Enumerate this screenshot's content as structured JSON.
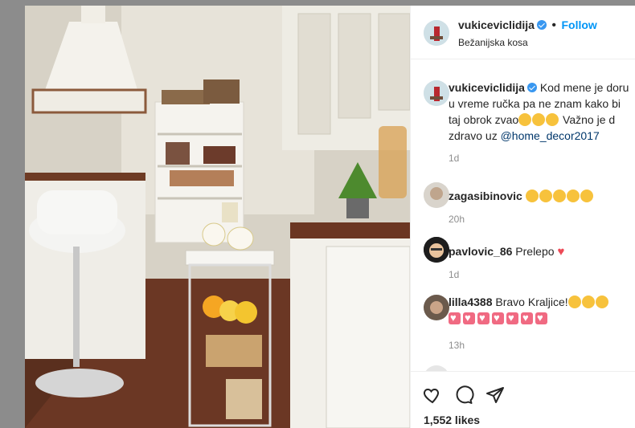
{
  "post": {
    "username": "vukiceviclidija",
    "follow_label": "Follow",
    "location": "Bežanijska kosa",
    "caption_lines": [
      "Kod mene je doru",
      "u vreme ručka pa ne znam kako bi",
      "taj obrok zvao",
      " Važno je d",
      "zdravo uz "
    ],
    "caption_mention": "@home_decor2017",
    "caption_time": "1d",
    "likes": "1,552 likes"
  },
  "comments": [
    {
      "user": "zagasibinovic",
      "text": "",
      "time": "20h"
    },
    {
      "user": "pavlovic_86",
      "text": "Prelepo",
      "time": "1d"
    },
    {
      "user": "lilla4388",
      "text": "Bravo Kraljice!",
      "time": "13h"
    }
  ],
  "icons": [
    "verified-badge",
    "heart-icon",
    "comment-icon",
    "share-icon"
  ],
  "colors": {
    "accent": "#0095f6",
    "mention": "#00376b",
    "text": "#262626",
    "muted": "#8e8e8e"
  }
}
